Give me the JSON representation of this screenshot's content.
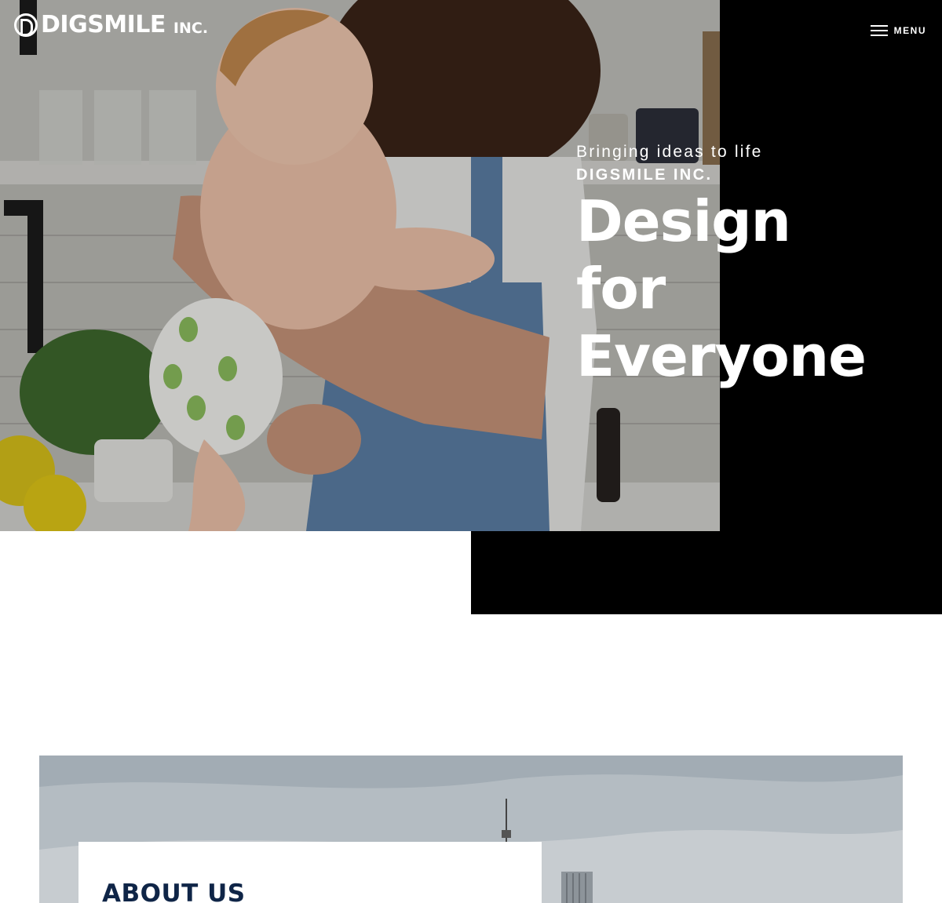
{
  "header": {
    "logo_text": "DIGSMILE",
    "logo_suffix": "INC.",
    "menu_label": "MENU"
  },
  "hero": {
    "tagline": "Bringing ideas to life",
    "company": "DIGSMILE INC.",
    "headline_lines": [
      "Design",
      "for",
      "Everyone"
    ]
  },
  "about": {
    "title": "ABOUT US"
  },
  "colors": {
    "panel": "#000000",
    "about_title": "#0f2547"
  }
}
